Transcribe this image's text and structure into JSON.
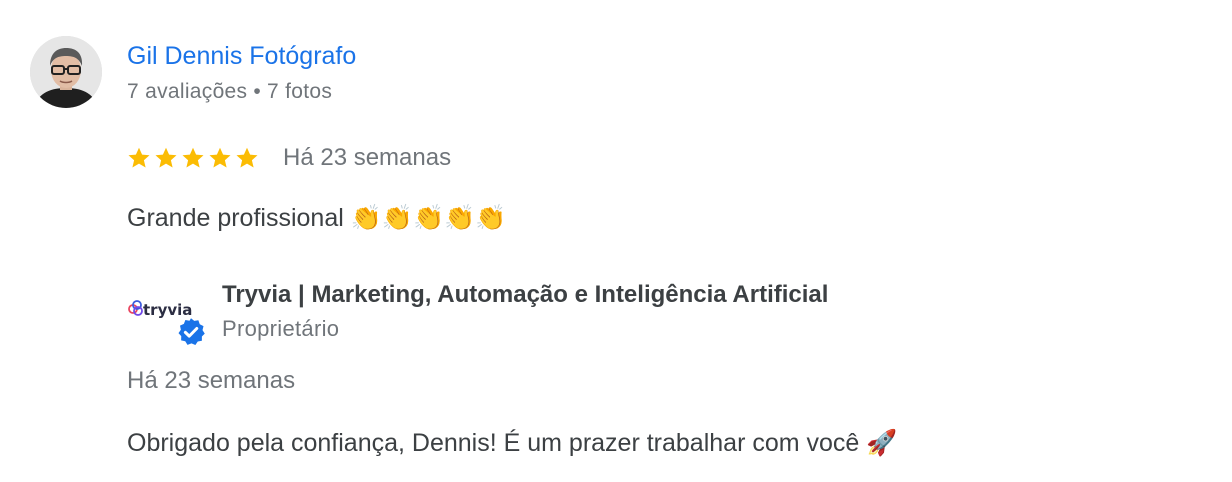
{
  "review": {
    "author": {
      "name": "Gil Dennis Fotógrafo",
      "reviews_count": "7 avaliações",
      "separator": "•",
      "photos_count": "7 fotos"
    },
    "rating": 5,
    "star_color": "#fbbc04",
    "date": "Há 23 semanas",
    "text": "Grande profissional 👏👏👏👏👏"
  },
  "owner_reply": {
    "logo_text": "tryvia",
    "badge_color": "#1a73e8",
    "name": "Tryvia | Marketing, Automação e Inteligência Artificial",
    "role": "Proprietário",
    "date": "Há 23 semanas",
    "text": "Obrigado pela confiança, Dennis! É um prazer trabalhar com você 🚀"
  },
  "colors": {
    "link": "#1a73e8",
    "text": "#3c4043",
    "muted": "#70757a"
  }
}
